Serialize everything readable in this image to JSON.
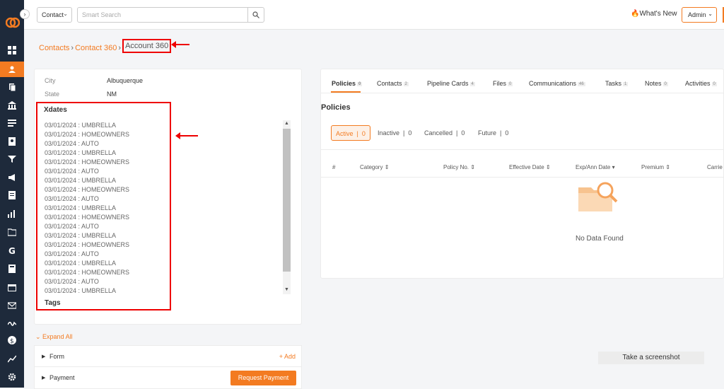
{
  "topbar": {
    "contact_select": "Contact",
    "search_placeholder": "Smart Search",
    "whats_new": "What's New",
    "admin": "Admin"
  },
  "breadcrumb": {
    "items": [
      "Contacts",
      "Contact 360"
    ],
    "current": "Account 360"
  },
  "left_panel": {
    "fields": [
      {
        "label": "City",
        "value": "Albuquerque"
      },
      {
        "label": "State",
        "value": "NM"
      }
    ],
    "xdates_title": "Xdates",
    "xdates": [
      "03/01/2024 : UMBRELLA",
      "03/01/2024 : HOMEOWNERS",
      "03/01/2024 : AUTO",
      "03/01/2024 : UMBRELLA",
      "03/01/2024 : HOMEOWNERS",
      "03/01/2024 : AUTO",
      "03/01/2024 : UMBRELLA",
      "03/01/2024 : HOMEOWNERS",
      "03/01/2024 : AUTO",
      "03/01/2024 : UMBRELLA",
      "03/01/2024 : HOMEOWNERS",
      "03/01/2024 : AUTO",
      "03/01/2024 : UMBRELLA",
      "03/01/2024 : HOMEOWNERS",
      "03/01/2024 : AUTO",
      "03/01/2024 : UMBRELLA",
      "03/01/2024 : HOMEOWNERS",
      "03/01/2024 : AUTO",
      "03/01/2024 : UMBRELLA"
    ],
    "tags_title": "Tags"
  },
  "expand_all": "Expand All",
  "accordion": {
    "form_label": "Form",
    "add_label": "+ Add",
    "payment_label": "Payment",
    "request_payment": "Request Payment"
  },
  "tabs": [
    {
      "label": "Policies",
      "count": "0"
    },
    {
      "label": "Contacts",
      "count": "2"
    },
    {
      "label": "Pipeline Cards",
      "count": "4"
    },
    {
      "label": "Files",
      "count": "0"
    },
    {
      "label": "Communications",
      "count": "46"
    },
    {
      "label": "Tasks",
      "count": "1"
    },
    {
      "label": "Notes",
      "count": "0"
    },
    {
      "label": "Activities",
      "count": "0"
    }
  ],
  "policies": {
    "title": "Policies",
    "status": [
      {
        "label": "Active",
        "count": "0"
      },
      {
        "label": "Inactive",
        "count": "0"
      },
      {
        "label": "Cancelled",
        "count": "0"
      },
      {
        "label": "Future",
        "count": "0"
      }
    ],
    "columns": [
      "#",
      "Category",
      "Policy No.",
      "Effective Date",
      "Exp/Ann Date",
      "Premium",
      "Carrie"
    ],
    "no_data": "No Data Found"
  },
  "screenshot_button": "Take a screenshot",
  "colors": {
    "accent": "#f37b21",
    "sidebar": "#1e2a3b",
    "annotation": "#e00000"
  }
}
